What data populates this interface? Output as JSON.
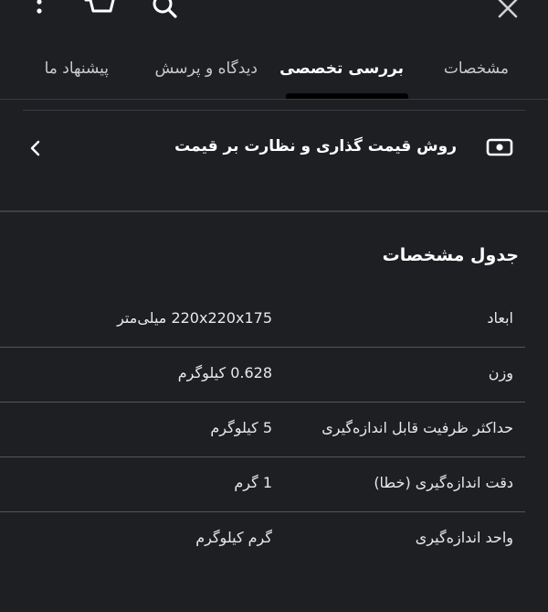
{
  "header": {
    "icons": [
      "close-icon",
      "search-icon",
      "cart-icon",
      "more-vertical-icon"
    ]
  },
  "tabs": [
    {
      "id": "specs",
      "label": "مشخصات",
      "active": false
    },
    {
      "id": "review",
      "label": "بررسی تخصصی",
      "active": true
    },
    {
      "id": "qa",
      "label": "دیدگاه و پرسش",
      "active": false
    },
    {
      "id": "suggest",
      "label": "پیشنهاد ما",
      "active": false
    }
  ],
  "pricing": {
    "label": "روش قیمت گذاری و نظارت بر قیمت",
    "icon": "money-icon"
  },
  "spec_table": {
    "title": "جدول مشخصات",
    "rows": [
      {
        "key": "ابعاد",
        "value": "220x220x175 میلی‌متر"
      },
      {
        "key": "وزن",
        "value": "0.628 کیلوگرم"
      },
      {
        "key": "حداکثر ظرفیت قابل اندازه‌گیری",
        "value": "5 کیلوگرم"
      },
      {
        "key": "دقت اندازه‌گیری (خطا)",
        "value": "1 گرم"
      },
      {
        "key": "واحد اندازه‌گیری",
        "value": "گرم کیلوگرم"
      }
    ]
  },
  "colors": {
    "background": "#1e1f23",
    "text": "#ffffff",
    "divider": "#3a3b40",
    "tab_indicator": "#000000"
  }
}
